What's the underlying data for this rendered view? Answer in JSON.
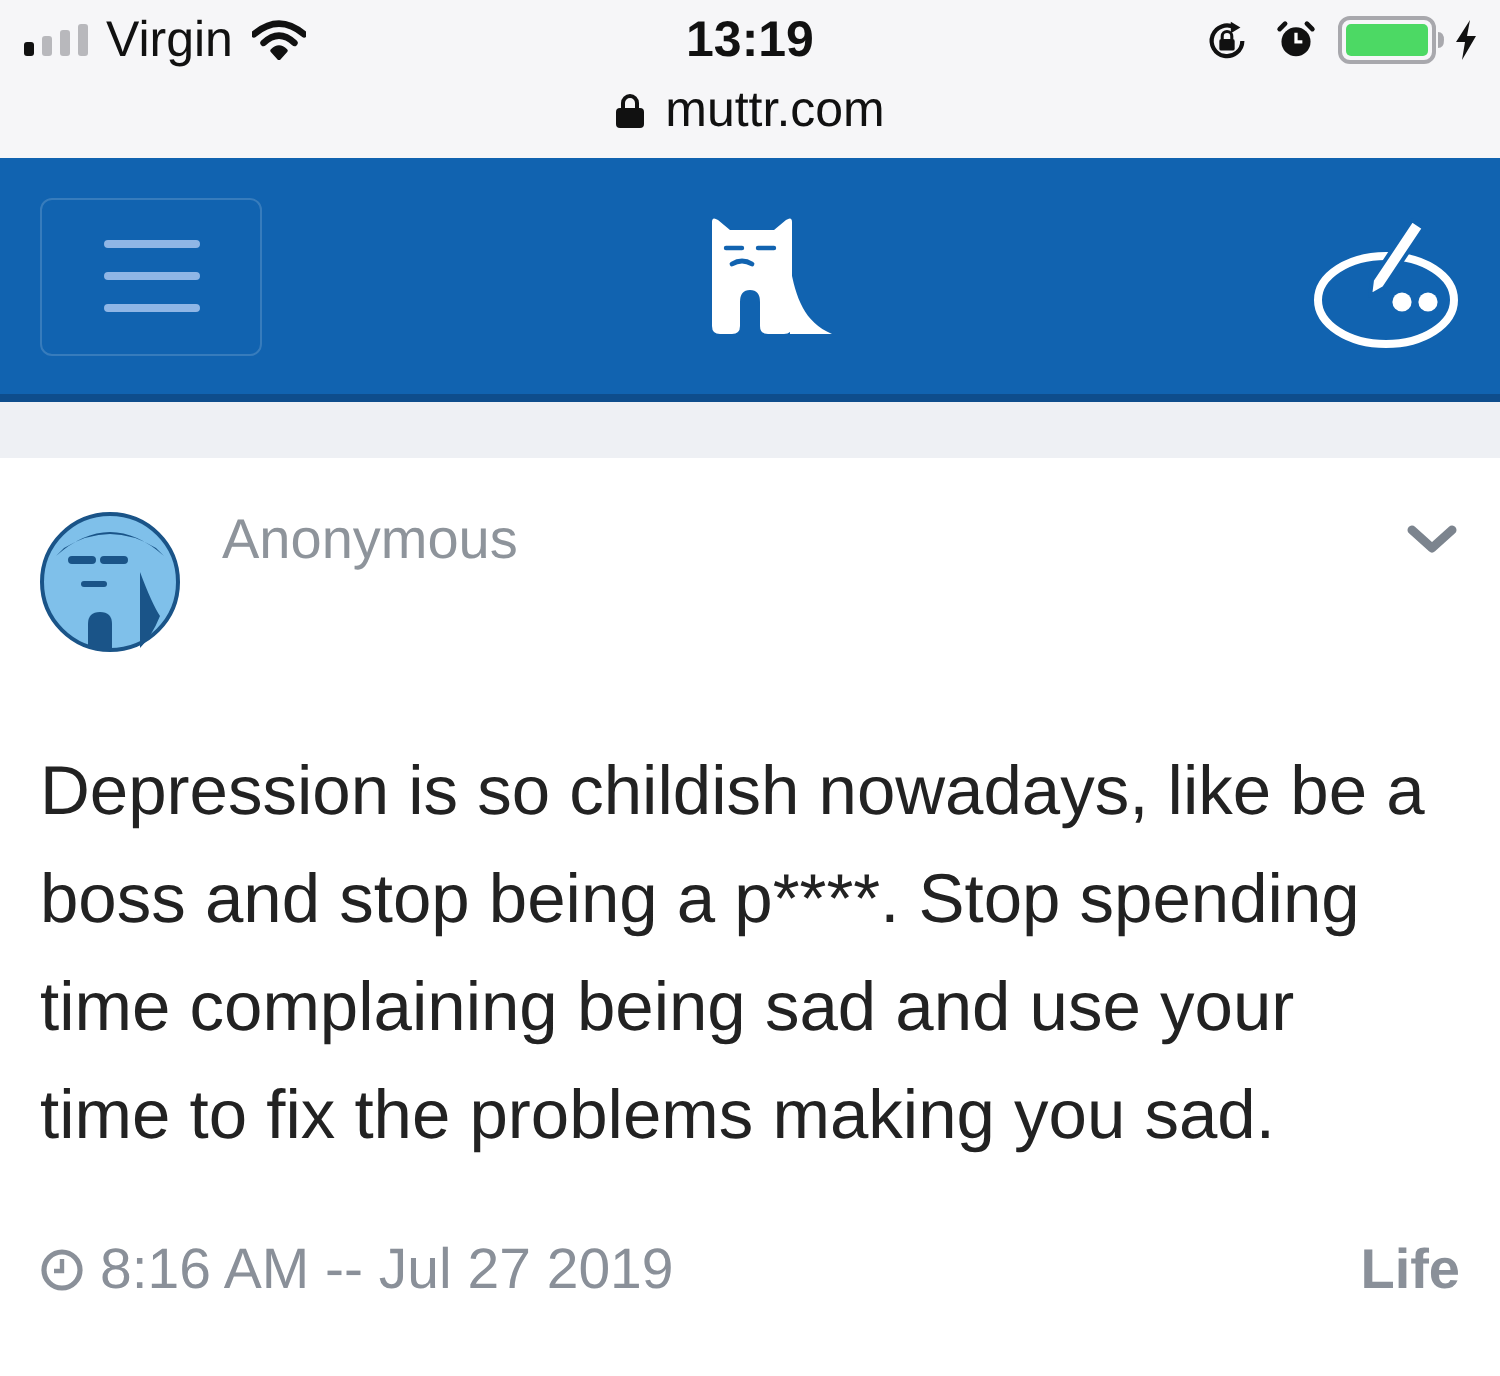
{
  "status_bar": {
    "carrier": "Virgin",
    "time": "13:19"
  },
  "address_bar": {
    "url": "muttr.com"
  },
  "post": {
    "author": "Anonymous",
    "body": "Depression is so childish nowadays, like be a boss and stop being a p****. Stop spending time complaining being sad and use your time to fix the problems making you sad.",
    "timestamp": "8:16 AM -- Jul 27 2019",
    "category": "Life"
  }
}
